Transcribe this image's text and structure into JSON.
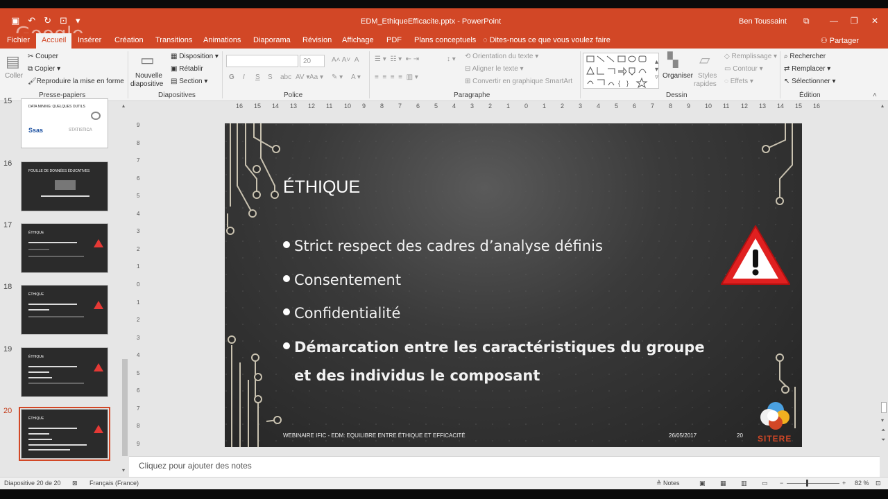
{
  "app": {
    "doc_title": "EDM_EthiqueEfficacite.pptx  -  PowerPoint",
    "user": "Ben Toussaint",
    "watermark": "Google",
    "accent": "#d24726"
  },
  "tabs": [
    "Fichier",
    "Accueil",
    "Insérer",
    "Création",
    "Transitions",
    "Animations",
    "Diaporama",
    "Révision",
    "Affichage",
    "PDF",
    "Plans conceptuels"
  ],
  "tell_me": "Dites-nous ce que vous voulez faire",
  "share": "Partager",
  "ribbon": {
    "clipboard": {
      "label": "Presse-papiers",
      "paste": "Coller",
      "cut": "Couper",
      "copy": "Copier",
      "format_painter": "Reproduire la mise en forme"
    },
    "slides": {
      "label": "Diapositives",
      "new_slide": "Nouvelle",
      "new_slide2": "diapositive",
      "layout": "Disposition",
      "reset": "Rétablir",
      "section": "Section"
    },
    "font": {
      "label": "Police",
      "size_placeholder": "20"
    },
    "paragraph": {
      "label": "Paragraphe",
      "text_direction": "Orientation du texte",
      "align_text": "Aligner le texte",
      "smartart": "Convertir en graphique SmartArt"
    },
    "drawing": {
      "label": "Dessin",
      "arrange": "Organiser",
      "styles": "Styles",
      "styles2": "rapides",
      "fill": "Remplissage",
      "outline": "Contour",
      "effects": "Effets"
    },
    "editing": {
      "label": "Édition",
      "find": "Rechercher",
      "replace": "Remplacer",
      "select": "Sélectionner"
    }
  },
  "thumbnails": [
    {
      "num": "15",
      "title": "DATA MINING: QUELQUES OUTILS"
    },
    {
      "num": "16",
      "title": "FOUILLE DE DONNÉES ÉDUCATIVES"
    },
    {
      "num": "17",
      "title": "ÉTHIQUE"
    },
    {
      "num": "18",
      "title": "ÉTHIQUE"
    },
    {
      "num": "19",
      "title": "ÉTHIQUE"
    },
    {
      "num": "20",
      "title": "ÉTHIQUE"
    }
  ],
  "slide": {
    "title": "ÉTHIQUE",
    "bullets": [
      "Strict respect des cadres d’analyse définis",
      "Consentement",
      "Confidentialité",
      "Démarcation entre les caractéristiques du groupe",
      "et des individus le composant"
    ],
    "footer_left": "WEBINAIRE IFIC - EDM: EQUILIBRE ENTRE ÉTHIQUE ET EFFICACITÉ",
    "footer_date": "26/05/2017",
    "footer_num": "20",
    "logo_text": "SITERE"
  },
  "ruler_h": [
    "16",
    "15",
    "14",
    "13",
    "12",
    "11",
    "10",
    "9",
    "8",
    "7",
    "6",
    "5",
    "4",
    "3",
    "2",
    "1",
    "0",
    "1",
    "2",
    "3",
    "4",
    "5",
    "6",
    "7",
    "8",
    "9",
    "10",
    "11",
    "12",
    "13",
    "14",
    "15",
    "16"
  ],
  "ruler_v": [
    "9",
    "8",
    "7",
    "6",
    "5",
    "4",
    "3",
    "2",
    "1",
    "0",
    "1",
    "2",
    "3",
    "4",
    "5",
    "6",
    "7",
    "8",
    "9"
  ],
  "notes_placeholder": "Cliquez pour ajouter des notes",
  "status": {
    "slide_count": "Diapositive 20 de 20",
    "language": "Français (France)",
    "notes": "Notes",
    "zoom": "82 %",
    "zoom_minus": "−",
    "zoom_plus": "+"
  }
}
